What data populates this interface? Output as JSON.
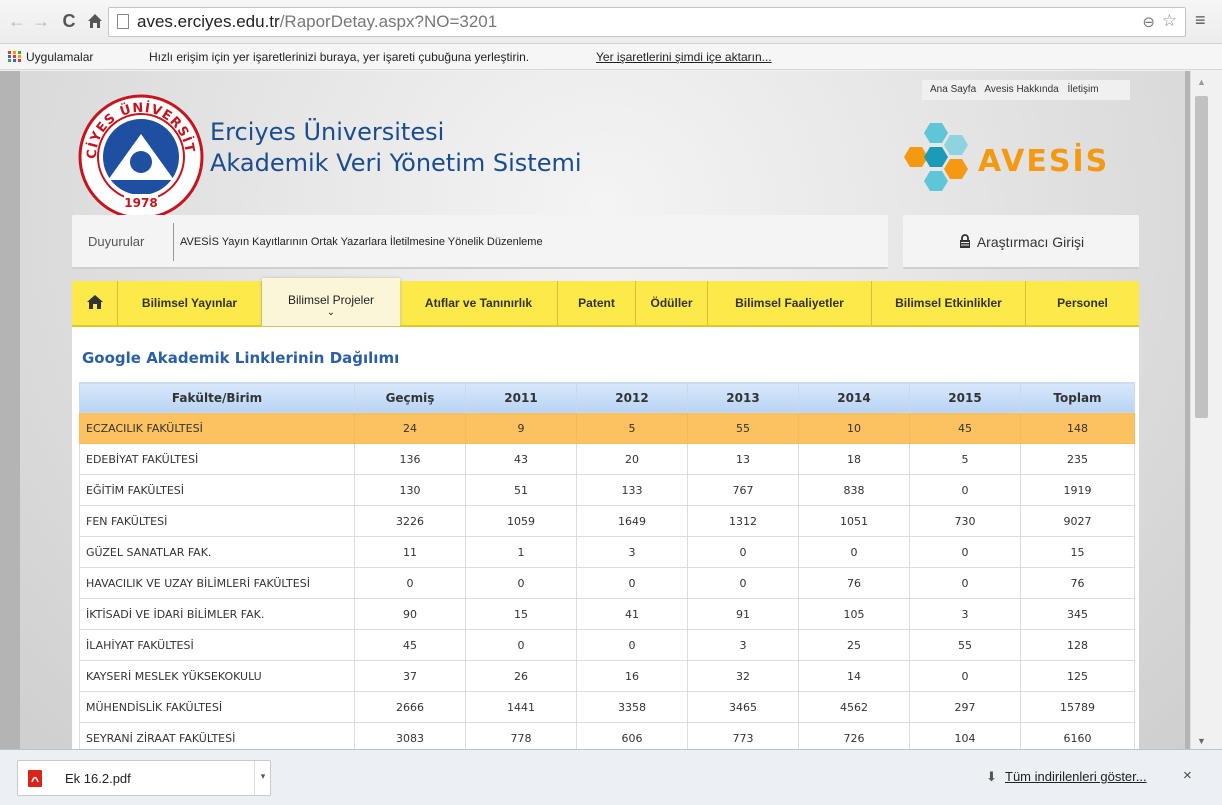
{
  "browser": {
    "url_domain": "aves.erciyes.edu.tr",
    "url_path": "/RaporDetay.aspx?NO=3201",
    "bookmarks_apps": "Uygulamalar",
    "bookmarks_hint": "Hızlı erişim için yer işaretlerinizi buraya, yer işareti çubuğuna yerleştirin.",
    "bookmarks_import": "Yer işaretlerini şimdi içe aktarın..."
  },
  "header": {
    "top_links": [
      "Ana Sayfa",
      "Avesis Hakkında",
      "İletişim"
    ],
    "uni_line1": "Erciyes Üniversitesi",
    "uni_line2": "Akademik Veri Yönetim Sistemi",
    "logo_text": "ERCİYES ÜNİVERSİTESİ",
    "logo_year": "1978",
    "avesis_text": "AVESİS"
  },
  "announcement": {
    "label": "Duyurular",
    "text": "AVESİS Yayın Kayıtlarının Ortak Yazarlara İletilmesine Yönelik Düzenleme"
  },
  "login": {
    "label": "Araştırmacı Girişi"
  },
  "nav": {
    "items": [
      "Bilimsel Yayınlar",
      "Bilimsel Projeler",
      "Atıflar ve Tanınırlık",
      "Patent",
      "Ödüller",
      "Bilimsel Faaliyetler",
      "Bilimsel Etkinlikler",
      "Personel"
    ]
  },
  "content": {
    "title": "Google Akademik Linklerinin Dağılımı",
    "columns": [
      "Fakülte/Birim",
      "Geçmiş",
      "2011",
      "2012",
      "2013",
      "2014",
      "2015",
      "Toplam"
    ],
    "rows": [
      [
        "ECZACILIK FAKÜLTESİ",
        "24",
        "9",
        "5",
        "55",
        "10",
        "45",
        "148"
      ],
      [
        "EDEBİYAT FAKÜLTESİ",
        "136",
        "43",
        "20",
        "13",
        "18",
        "5",
        "235"
      ],
      [
        "EĞİTİM FAKÜLTESİ",
        "130",
        "51",
        "133",
        "767",
        "838",
        "0",
        "1919"
      ],
      [
        "FEN FAKÜLTESİ",
        "3226",
        "1059",
        "1649",
        "1312",
        "1051",
        "730",
        "9027"
      ],
      [
        "GÜZEL SANATLAR FAK.",
        "11",
        "1",
        "3",
        "0",
        "0",
        "0",
        "15"
      ],
      [
        "HAVACILIK VE UZAY BİLİMLERİ FAKÜLTESİ",
        "0",
        "0",
        "0",
        "0",
        "76",
        "0",
        "76"
      ],
      [
        "İKTİSADİ VE İDARİ BİLİMLER FAK.",
        "90",
        "15",
        "41",
        "91",
        "105",
        "3",
        "345"
      ],
      [
        "İLAHİYAT FAKÜLTESİ",
        "45",
        "0",
        "0",
        "3",
        "25",
        "55",
        "128"
      ],
      [
        "KAYSERİ MESLEK YÜKSEKOKULU",
        "37",
        "26",
        "16",
        "32",
        "14",
        "0",
        "125"
      ],
      [
        "MÜHENDİSLİK FAKÜLTESİ",
        "2666",
        "1441",
        "3358",
        "3465",
        "4562",
        "297",
        "15789"
      ],
      [
        "SEYRANİ ZİRAAT FAKÜLTESİ",
        "3083",
        "778",
        "606",
        "773",
        "726",
        "104",
        "6160"
      ]
    ]
  },
  "downloads": {
    "file_name": "Ek 16.2.pdf",
    "show_all": "Tüm indirilenleri göster..."
  },
  "colors": {
    "nav_yellow": "#fce94a",
    "highlight_row": "#fcc260",
    "title_blue": "#2a5fa5",
    "avesis_orange": "#f39a12",
    "avesis_teal": "#3aaec5"
  }
}
